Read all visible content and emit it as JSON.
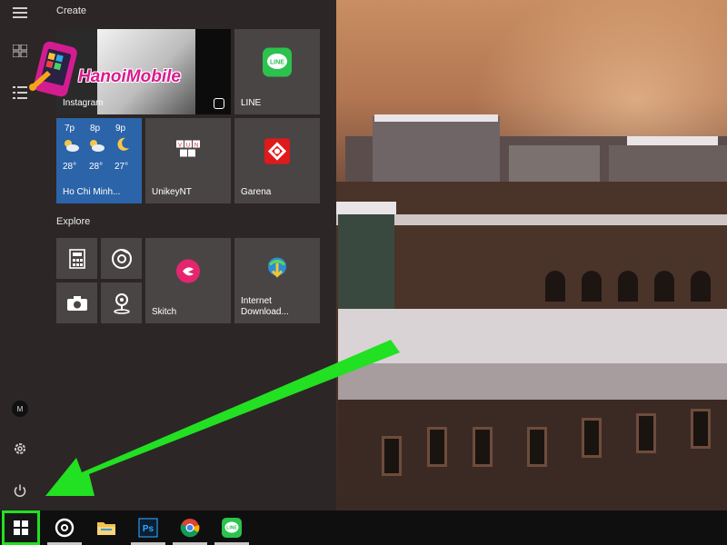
{
  "start_menu": {
    "groups": [
      {
        "label": "Create"
      },
      {
        "label": "Explore"
      }
    ],
    "tiles": [
      {
        "label": "Instagram"
      },
      {
        "label": "LINE"
      },
      {
        "label": "Ho Chi Minh..."
      },
      {
        "label": "UnikeyNT"
      },
      {
        "label": "Garena"
      },
      {
        "label": "Skitch"
      },
      {
        "label": "Internet\nDownload..."
      }
    ],
    "weather": {
      "times": [
        "7p",
        "8p",
        "9p"
      ],
      "temps": [
        "28°",
        "28°",
        "27°"
      ]
    }
  },
  "watermark": {
    "brand": "HanoiMobile"
  },
  "colors": {
    "highlight_green": "#22e022",
    "tile_bg": "#4a4545",
    "weather_bg": "#2b64a9"
  },
  "icons": [
    "hamburger-menu-icon",
    "all-apps-icon",
    "list-icon",
    "user-avatar-icon",
    "settings-gear-icon",
    "power-icon",
    "windows-start-icon",
    "cortana-icon",
    "file-explorer-icon",
    "photoshop-icon",
    "chrome-icon",
    "line-icon"
  ]
}
